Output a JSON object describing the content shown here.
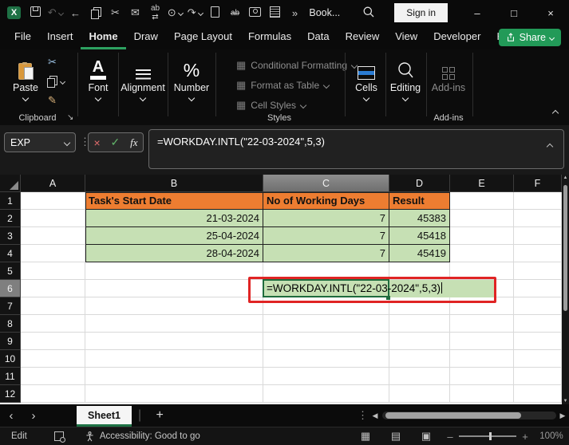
{
  "title_bar": {
    "window_title": "Book...",
    "sign_in_label": "Sign in",
    "minimize": "–",
    "maximize": "□",
    "close": "×"
  },
  "qat_glyphs": {
    "excel_logo": "X",
    "undo": "↶",
    "back": "←",
    "cut": "✂",
    "draft_email": "✉",
    "find_replace_ab": "ab",
    "find_replace_arrows": "⇄",
    "touch_mode": "⊙",
    "redo": "↷",
    "ink_replay_ab": "ab",
    "more_commands": "»"
  },
  "ribbon": {
    "tabs": [
      "File",
      "Insert",
      "Home",
      "Draw",
      "Page Layout",
      "Formulas",
      "Data",
      "Review",
      "View",
      "Developer",
      "Help"
    ],
    "active_tab": "Home",
    "share_label": "Share",
    "clipboard": {
      "paste_label": "Paste",
      "group_label": "Clipboard",
      "format_painter_glyph": "✎",
      "cut_glyph": "✂"
    },
    "font_group": {
      "label": "Font",
      "icon_letter": "A"
    },
    "alignment_group": {
      "label": "Alignment"
    },
    "number_group": {
      "label": "Number",
      "icon_glyph": "%"
    },
    "styles_group": {
      "items": [
        "Conditional Formatting",
        "Format as Table",
        "Cell Styles"
      ],
      "item_icon_glyph": "▦",
      "group_label": "Styles"
    },
    "cells_group": {
      "label": "Cells"
    },
    "editing_group": {
      "label": "Editing"
    },
    "addins_group": {
      "label": "Add-ins",
      "group_label": "Add-ins"
    }
  },
  "formula_bar": {
    "name_box_value": "EXP",
    "dots": "⋮",
    "cancel_glyph": "×",
    "enter_glyph": "✓",
    "fx_label": "fx",
    "formula": "=WORKDAY.INTL(\"22-03-2024\",5,3)"
  },
  "grid": {
    "columns": [
      "A",
      "B",
      "C",
      "D",
      "E",
      "F"
    ],
    "active_column": "C",
    "row_numbers": [
      "1",
      "2",
      "3",
      "4",
      "5",
      "6",
      "7",
      "8",
      "9",
      "10",
      "11",
      "12"
    ],
    "active_row": "6",
    "table": {
      "headers": {
        "start_date": "Task's Start Date",
        "working_days": "No of Working Days",
        "result": "Result"
      },
      "rows": [
        {
          "start_date": "21-03-2024",
          "working_days": "7",
          "result": "45383"
        },
        {
          "start_date": "25-04-2024",
          "working_days": "7",
          "result": "45418"
        },
        {
          "start_date": "28-04-2024",
          "working_days": "7",
          "result": "45419"
        }
      ]
    },
    "editing_cell": {
      "ref": "C6",
      "text": "=WORKDAY.INTL(\"22-03-2024\",5,3)"
    },
    "scroll_glyphs": {
      "up": "▲",
      "down": "▼",
      "left": "◀",
      "right": "▶"
    }
  },
  "sheet_bar": {
    "prev_glyph": "‹",
    "next_glyph": "›",
    "sheet_tabs": [
      "Sheet1"
    ],
    "active_sheet": "Sheet1",
    "add_sheet_glyph": "+",
    "dots": "⋮"
  },
  "status_bar": {
    "mode": "Edit",
    "accessibility": "Accessibility: Good to go",
    "view_glyphs": {
      "normal": "▦",
      "page_layout": "▤",
      "page_break": "▣"
    },
    "zoom_out": "–",
    "zoom_in": "+",
    "zoom_level": "100%"
  },
  "colors": {
    "accent_green": "#1E7145",
    "share_green": "#229a58",
    "tab_underline_green": "#2DA160",
    "table_header_orange": "#ED7D31",
    "table_row_green": "#C6E0B4",
    "annotation_red": "#E02424",
    "selected_header_gray": "#7f7f7f",
    "edit_border_green": "#1F6B3D"
  }
}
